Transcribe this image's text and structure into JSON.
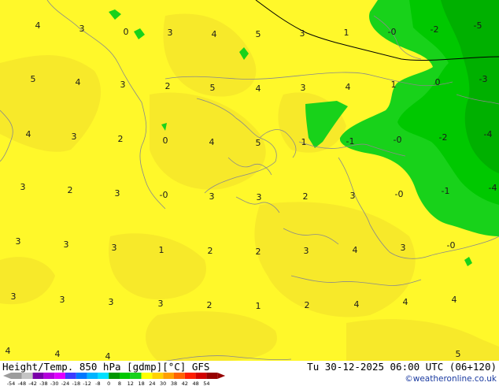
{
  "map": {
    "title": "Height/Temp. 850 hPa [gdmp][°C] GFS",
    "datetime": "Tu 30-12-2025 06:00 UTC (06+120)",
    "credit": "©weatheronline.co.uk",
    "colors": {
      "yellow_light": "#fff82a",
      "yellow_dark": "#f7e92a",
      "green_light": "#18d21a",
      "green_mid": "#00c800",
      "green_dark": "#00b000"
    },
    "temperature_labels": [
      "4",
      "3",
      "0",
      "3",
      "4",
      "5",
      "3",
      "1",
      "-0",
      "-2",
      "-5",
      "5",
      "4",
      "3",
      "2",
      "5",
      "4",
      "3",
      "4",
      "1",
      "0",
      "-3",
      "4",
      "3",
      "2",
      "0",
      "4",
      "5",
      "1",
      "-1",
      "-0",
      "-2",
      "-4",
      "3",
      "2",
      "3",
      "-0",
      "3",
      "3",
      "2",
      "3",
      "-0",
      "-1",
      "-4",
      "3",
      "3",
      "3",
      "1",
      "2",
      "2",
      "3",
      "4",
      "3",
      "-0",
      "3",
      "3",
      "3",
      "3",
      "2",
      "1",
      "2",
      "4",
      "4",
      "4",
      "4",
      "4",
      "4",
      "5"
    ],
    "scale": {
      "labels": [
        "-54",
        "-48",
        "-42",
        "-38",
        "-30",
        "-24",
        "-18",
        "-12",
        "-8",
        "0",
        "8",
        "12",
        "18",
        "24",
        "30",
        "38",
        "42",
        "48",
        "54"
      ],
      "colors": [
        "#9c9c9c",
        "#c4c4c4",
        "#7a00a8",
        "#b400dc",
        "#e000ff",
        "#3c3cff",
        "#0078ff",
        "#00b4ff",
        "#00e0ff",
        "#009600",
        "#00c800",
        "#18d21a",
        "#ffff00",
        "#ffd200",
        "#ffa000",
        "#ff6400",
        "#ff1e00",
        "#d20000",
        "#960000"
      ]
    }
  }
}
